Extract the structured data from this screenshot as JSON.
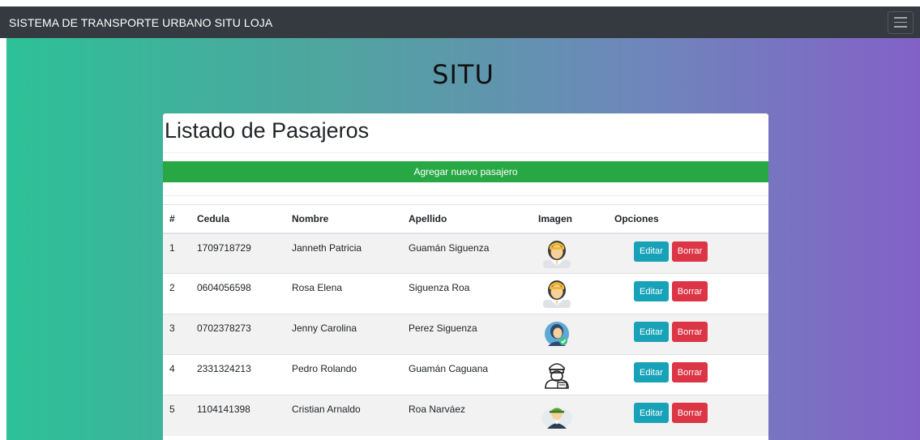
{
  "navbar": {
    "brand": "SISTEMA DE TRANSPORTE URBANO SITU LOJA"
  },
  "hero": {
    "title": "SITU"
  },
  "card": {
    "title": "Listado de Pasajeros",
    "add_button": "Agregar nuevo pasajero"
  },
  "table": {
    "headers": [
      "#",
      "Cedula",
      "Nombre",
      "Apellido",
      "Imagen",
      "Opciones"
    ],
    "rows": [
      {
        "num": "1",
        "cedula": "1709718729",
        "nombre": "Janneth Patricia",
        "apellido": "Guamán Siguenza",
        "icon": "female-avatar-icon"
      },
      {
        "num": "2",
        "cedula": "0604056598",
        "nombre": "Rosa Elena",
        "apellido": "Siguenza Roa",
        "icon": "female-avatar-icon"
      },
      {
        "num": "3",
        "cedula": "0702378273",
        "nombre": "Jenny Carolina",
        "apellido": "Perez Siguenza",
        "icon": "female-verified-avatar-icon"
      },
      {
        "num": "4",
        "cedula": "2331324213",
        "nombre": "Pedro Rolando",
        "apellido": "Guamán Caguana",
        "icon": "male-id-avatar-icon"
      },
      {
        "num": "5",
        "cedula": "1104141398",
        "nombre": "Cristian Arnaldo",
        "apellido": "Roa Narváez",
        "icon": "male-cap-avatar-icon"
      }
    ],
    "edit_label": "Editar",
    "delete_label": "Borrar"
  },
  "colors": {
    "navbar": "#343a40",
    "gradient_start": "#2dc197",
    "gradient_end": "#8261c7",
    "add_button": "#28a745",
    "edit_button": "#17a2b8",
    "delete_button": "#dc3545"
  }
}
